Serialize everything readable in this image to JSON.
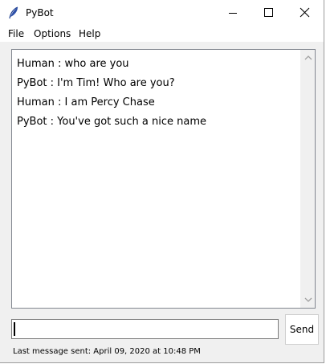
{
  "window": {
    "title": "PyBot",
    "app_icon": "feather-icon",
    "controls": [
      "minimize-icon",
      "maximize-icon",
      "close-icon"
    ]
  },
  "menu": {
    "items": [
      {
        "label": "File"
      },
      {
        "label": "Options"
      },
      {
        "label": "Help"
      }
    ]
  },
  "chat": {
    "lines": [
      "Human : who are you",
      "PyBot : I'm Tim! Who are you?",
      "Human : I am Percy Chase",
      "PyBot : You've got such a nice name"
    ]
  },
  "input": {
    "value": ""
  },
  "send_label": "Send",
  "status": {
    "text": "Last message sent: April 09, 2020 at 10:48 PM"
  }
}
